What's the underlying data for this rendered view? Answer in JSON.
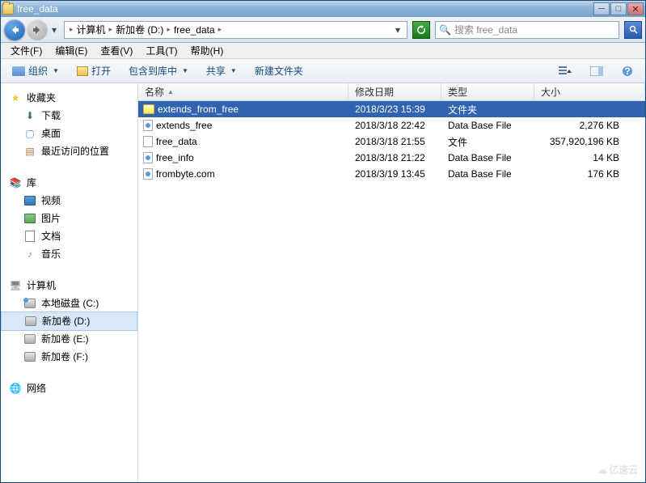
{
  "window": {
    "title": "free_data"
  },
  "nav": {
    "breadcrumbs": [
      {
        "label": "计算机"
      },
      {
        "label": "新加卷 (D:)"
      },
      {
        "label": "free_data"
      }
    ],
    "search_placeholder": "搜索 free_data"
  },
  "menubar": [
    {
      "label": "文件(F)"
    },
    {
      "label": "编辑(E)"
    },
    {
      "label": "查看(V)"
    },
    {
      "label": "工具(T)"
    },
    {
      "label": "帮助(H)"
    }
  ],
  "toolbar": {
    "organize": "组织",
    "open": "打开",
    "include": "包含到库中",
    "share": "共享",
    "newfolder": "新建文件夹"
  },
  "sidebar": {
    "favorites": {
      "label": "收藏夹",
      "items": [
        {
          "label": "下载"
        },
        {
          "label": "桌面"
        },
        {
          "label": "最近访问的位置"
        }
      ]
    },
    "libraries": {
      "label": "库",
      "items": [
        {
          "label": "视频"
        },
        {
          "label": "图片"
        },
        {
          "label": "文档"
        },
        {
          "label": "音乐"
        }
      ]
    },
    "computer": {
      "label": "计算机",
      "items": [
        {
          "label": "本地磁盘 (C:)"
        },
        {
          "label": "新加卷 (D:)"
        },
        {
          "label": "新加卷 (E:)"
        },
        {
          "label": "新加卷 (F:)"
        }
      ]
    },
    "network": {
      "label": "网络"
    }
  },
  "columns": {
    "name": "名称",
    "date": "修改日期",
    "type": "类型",
    "size": "大小"
  },
  "files": [
    {
      "name": "extends_from_free",
      "date": "2018/3/23 15:39",
      "type": "文件夹",
      "size": "",
      "icon": "folder",
      "selected": true
    },
    {
      "name": "extends_free",
      "date": "2018/3/18 22:42",
      "type": "Data Base File",
      "size": "2,276 KB",
      "icon": "db"
    },
    {
      "name": "free_data",
      "date": "2018/3/18 21:55",
      "type": "文件",
      "size": "357,920,196 KB",
      "icon": "file"
    },
    {
      "name": "free_info",
      "date": "2018/3/18 21:22",
      "type": "Data Base File",
      "size": "14 KB",
      "icon": "db"
    },
    {
      "name": "frombyte.com",
      "date": "2018/3/19 13:45",
      "type": "Data Base File",
      "size": "176 KB",
      "icon": "db"
    }
  ],
  "watermark": "亿速云"
}
